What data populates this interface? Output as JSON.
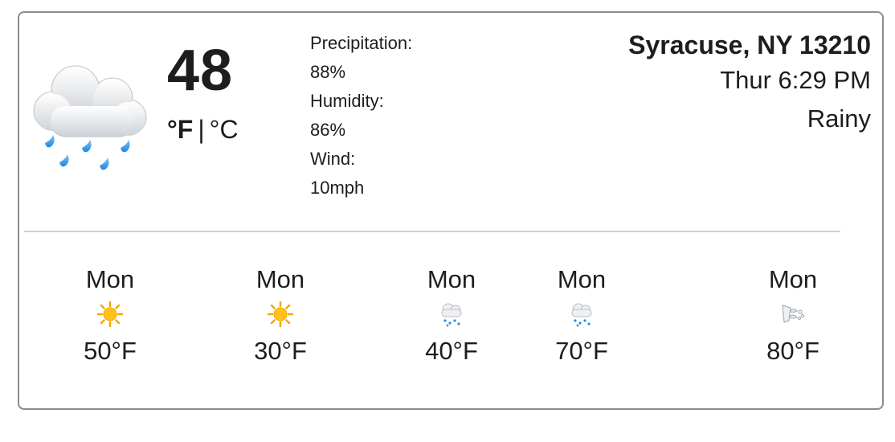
{
  "current": {
    "icon": "cloud-with-rain-icon",
    "temperature": "48",
    "unit_f": "°F",
    "unit_separator": "|",
    "unit_c": "°C",
    "precipitation_label": "Precipitation:",
    "precipitation_value": "88%",
    "humidity_label": "Humidity:",
    "humidity_value": "86%",
    "wind_label": "Wind:",
    "wind_value": "10mph"
  },
  "location": {
    "city": "Syracuse, NY 13210",
    "datetime": "Thur 6:29 PM",
    "condition": "Rainy"
  },
  "forecast": [
    {
      "day": "Mon",
      "icon": "sun-icon",
      "temp": "50°F"
    },
    {
      "day": "Mon",
      "icon": "sun-icon",
      "temp": "30°F"
    },
    {
      "day": "Mon",
      "icon": "rain-cloud-icon",
      "temp": "40°F"
    },
    {
      "day": "Mon",
      "icon": "rain-cloud-icon",
      "temp": "70°F"
    },
    {
      "day": "Mon",
      "icon": "wind-icon",
      "temp": "80°F"
    }
  ],
  "colors": {
    "text": "#1d1d1f",
    "border": "#8c8c8c",
    "divider": "#d0d0d0",
    "rain_drop": "#2a8fe0",
    "sun": "#f7b500"
  }
}
